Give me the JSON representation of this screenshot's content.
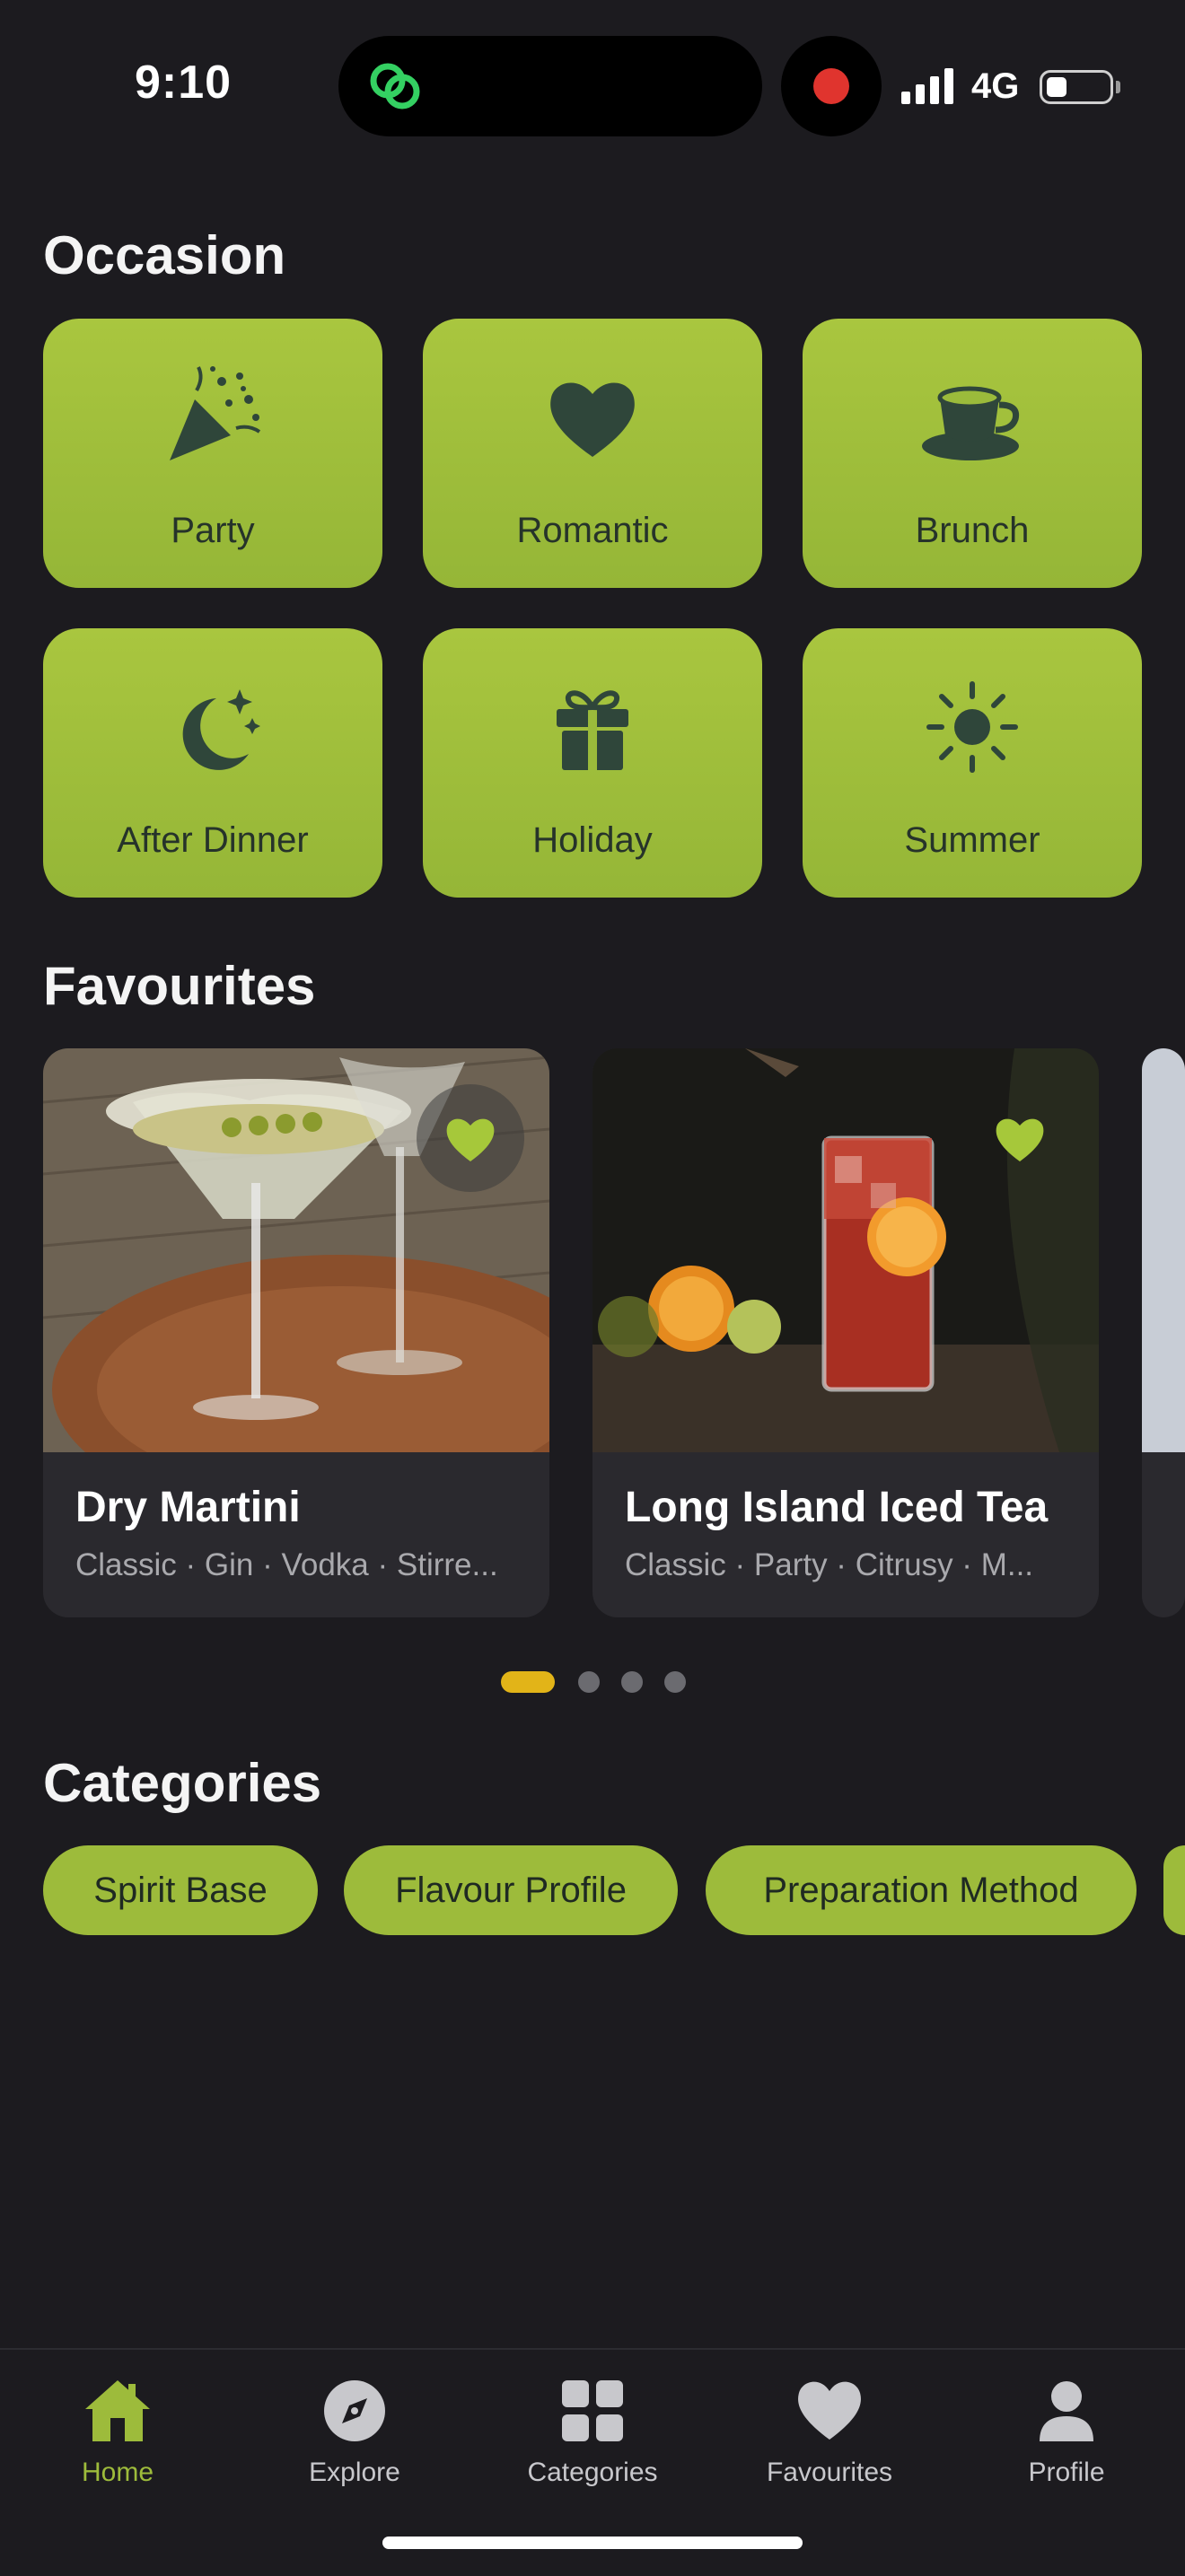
{
  "status_bar": {
    "time": "9:10",
    "network": "4G",
    "recording": true
  },
  "occasion": {
    "title": "Occasion",
    "tiles": [
      {
        "label": "Party",
        "icon": "party-popper-icon"
      },
      {
        "label": "Romantic",
        "icon": "heart-icon"
      },
      {
        "label": "Brunch",
        "icon": "cup-icon"
      },
      {
        "label": "After Dinner",
        "icon": "moon-stars-icon"
      },
      {
        "label": "Holiday",
        "icon": "gift-icon"
      },
      {
        "label": "Summer",
        "icon": "sun-icon"
      }
    ]
  },
  "favourites": {
    "title": "Favourites",
    "cards": [
      {
        "name": "Dry Martini",
        "tags": "Classic · Gin · Vodka · Stirre...",
        "favourited": true
      },
      {
        "name": "Long Island Iced Tea",
        "tags": "Classic · Party · Citrusy · M...",
        "favourited": true
      }
    ],
    "page_count": 4,
    "active_page": 1
  },
  "categories": {
    "title": "Categories",
    "chips": [
      "Spirit Base",
      "Flavour Profile",
      "Preparation Method"
    ]
  },
  "tabbar": {
    "items": [
      {
        "label": "Home",
        "icon": "home-icon",
        "active": true
      },
      {
        "label": "Explore",
        "icon": "compass-icon",
        "active": false
      },
      {
        "label": "Categories",
        "icon": "grid-icon",
        "active": false
      },
      {
        "label": "Favourites",
        "icon": "heart-icon",
        "active": false
      },
      {
        "label": "Profile",
        "icon": "person-icon",
        "active": false
      }
    ]
  },
  "colors": {
    "background": "#1c1b1f",
    "accent": "#9dbb3b",
    "indicator": "#e2b418",
    "card": "#2a292e"
  }
}
